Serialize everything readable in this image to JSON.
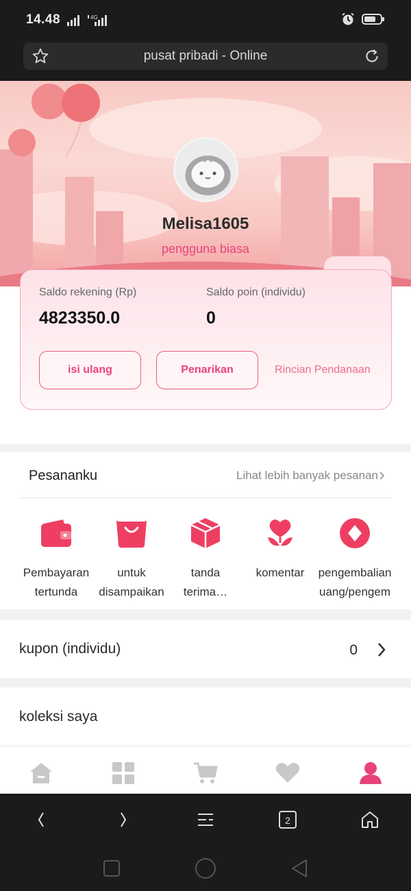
{
  "status_bar": {
    "time": "14.48",
    "network_label": "4G"
  },
  "address_bar": {
    "title": "pusat pribadi - Online"
  },
  "profile": {
    "username": "Melisa1605",
    "user_type": "pengguna biasa"
  },
  "balance": {
    "account_label": "Saldo rekening (Rp)",
    "account_value": "4823350.0",
    "points_label": "Saldo poin (individu)",
    "points_value": "0",
    "topup_label": "isi ulang",
    "withdraw_label": "Penarikan",
    "details_link": "Rincian Pendanaan"
  },
  "orders": {
    "title": "Pesananku",
    "more_link": "Lihat lebih banyak pesanan",
    "items": [
      {
        "line1": "Pembayaran",
        "line2": "tertunda",
        "icon": "wallet-icon"
      },
      {
        "line1": "untuk",
        "line2": "disampaikan",
        "icon": "shopping-bag-icon"
      },
      {
        "line1": "tanda",
        "line2": "terima…",
        "icon": "package-icon"
      },
      {
        "line1": "komentar",
        "line2": "",
        "icon": "flower-icon"
      },
      {
        "line1": "pengembalian",
        "line2": "uang/pengem",
        "icon": "diamond-icon"
      }
    ]
  },
  "coupon": {
    "label": "kupon (individu)",
    "value": "0"
  },
  "collection": {
    "label": "koleksi saya"
  },
  "colors": {
    "accent": "#e8447a",
    "inactive_nav": "#c8c8c8",
    "browser_bar": "#1b1b1b"
  },
  "bottom_nav": [
    "home-icon",
    "grid-icon",
    "cart-icon",
    "heart-icon",
    "user-icon"
  ],
  "browser_bar": {
    "tab_count": "2"
  }
}
